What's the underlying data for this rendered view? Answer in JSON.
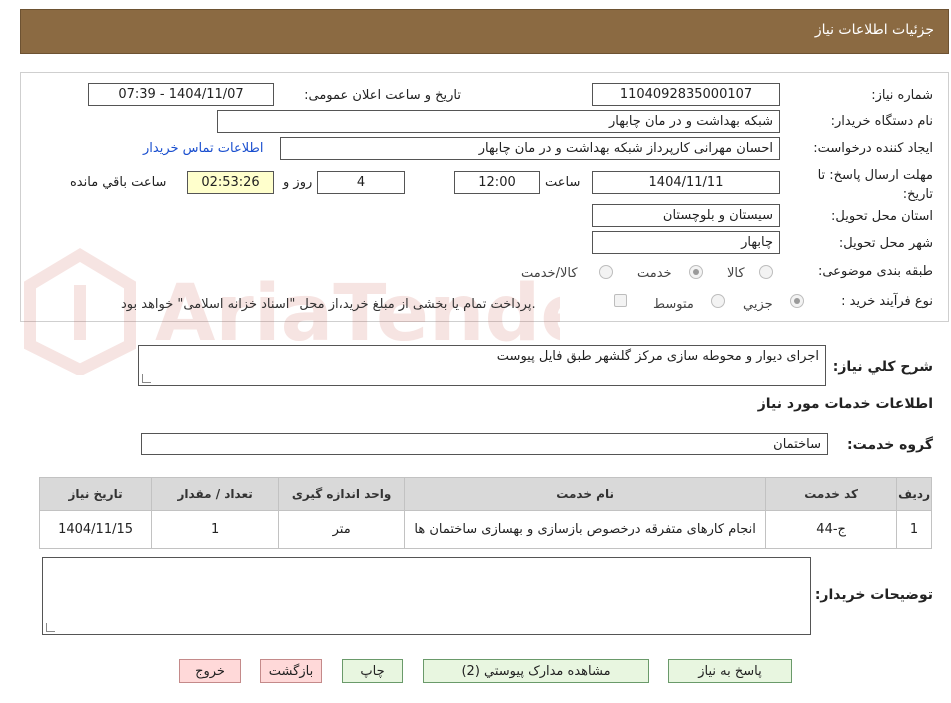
{
  "header": {
    "title": "جزئیات اطلاعات نیاز"
  },
  "fields": {
    "need_number": {
      "label": "شماره نیاز:",
      "value": "1104092835000107"
    },
    "announce_datetime": {
      "label": "تاریخ و ساعت اعلان عمومی:",
      "value": "1404/11/07 - 07:39"
    },
    "buyer_org": {
      "label": "نام دستگاه خریدار:",
      "value": "شبکه بهداشت و در مان چابهار"
    },
    "requester": {
      "label": "ایجاد کننده درخواست:",
      "value": "احسان مهرانی کارپرداز شبکه بهداشت و در مان چابهار"
    },
    "contact_link": "اطلاعات تماس خریدار",
    "deadline": {
      "label": "مهلت ارسال پاسخ: تا تاریخ:",
      "date": "1404/11/11",
      "time_label": "ساعت",
      "time": "12:00",
      "days": "4",
      "days_label": "روز و",
      "remaining": "02:53:26",
      "remaining_label": "ساعت باقي مانده"
    },
    "province": {
      "label": "استان محل تحویل:",
      "value": "سیستان و بلوچستان"
    },
    "city": {
      "label": "شهر محل تحویل:",
      "value": "چابهار"
    },
    "category": {
      "label": "طبقه بندی موضوعی:",
      "options": [
        "کالا",
        "خدمت",
        "کالا/خدمت"
      ],
      "selected": "خدمت"
    },
    "purchase_process": {
      "label": "نوع فرآیند خرید :",
      "options": [
        "جزیي",
        "متوسط"
      ],
      "selected": "جزیي",
      "treasury_note": "پرداخت تمام یا بخشی از مبلغ خرید،از محل \"اسناد خزانه اسلامی\" خواهد بود."
    }
  },
  "description": {
    "label": "شرح کلي نياز:",
    "value": "اجرای دیوار و محوطه سازی مرکز گلشهر طبق فایل پیوست"
  },
  "services_title": "اطلاعات خدمات مورد نیاز",
  "service_group": {
    "label": "گروه خدمت:",
    "value": "ساختمان"
  },
  "table": {
    "headers": [
      "ردیف",
      "کد خدمت",
      "نام خدمت",
      "واحد اندازه گیری",
      "تعداد / مقدار",
      "تاریخ نیاز"
    ],
    "rows": [
      [
        "1",
        "ج-44",
        "انجام کارهای متفرقه درخصوص بازسازی و بهسازی ساختمان ها",
        "متر",
        "1",
        "1404/11/15"
      ]
    ]
  },
  "buyer_notes": {
    "label": "توضیحات خریدار:",
    "value": ""
  },
  "buttons": {
    "reply": "پاسخ به نیاز",
    "attachments": "مشاهده مدارک پیوستي (2)",
    "print": "چاپ",
    "back": "بازگشت",
    "exit": "خروج"
  },
  "watermark": "AriaTender.neT",
  "colors": {
    "header": "#8b6a42",
    "timer_bg": "#ffffcc",
    "link": "#1a4fcf",
    "button_bg": "#e8f6e0",
    "button_danger_bg": "#ffd9d9"
  }
}
